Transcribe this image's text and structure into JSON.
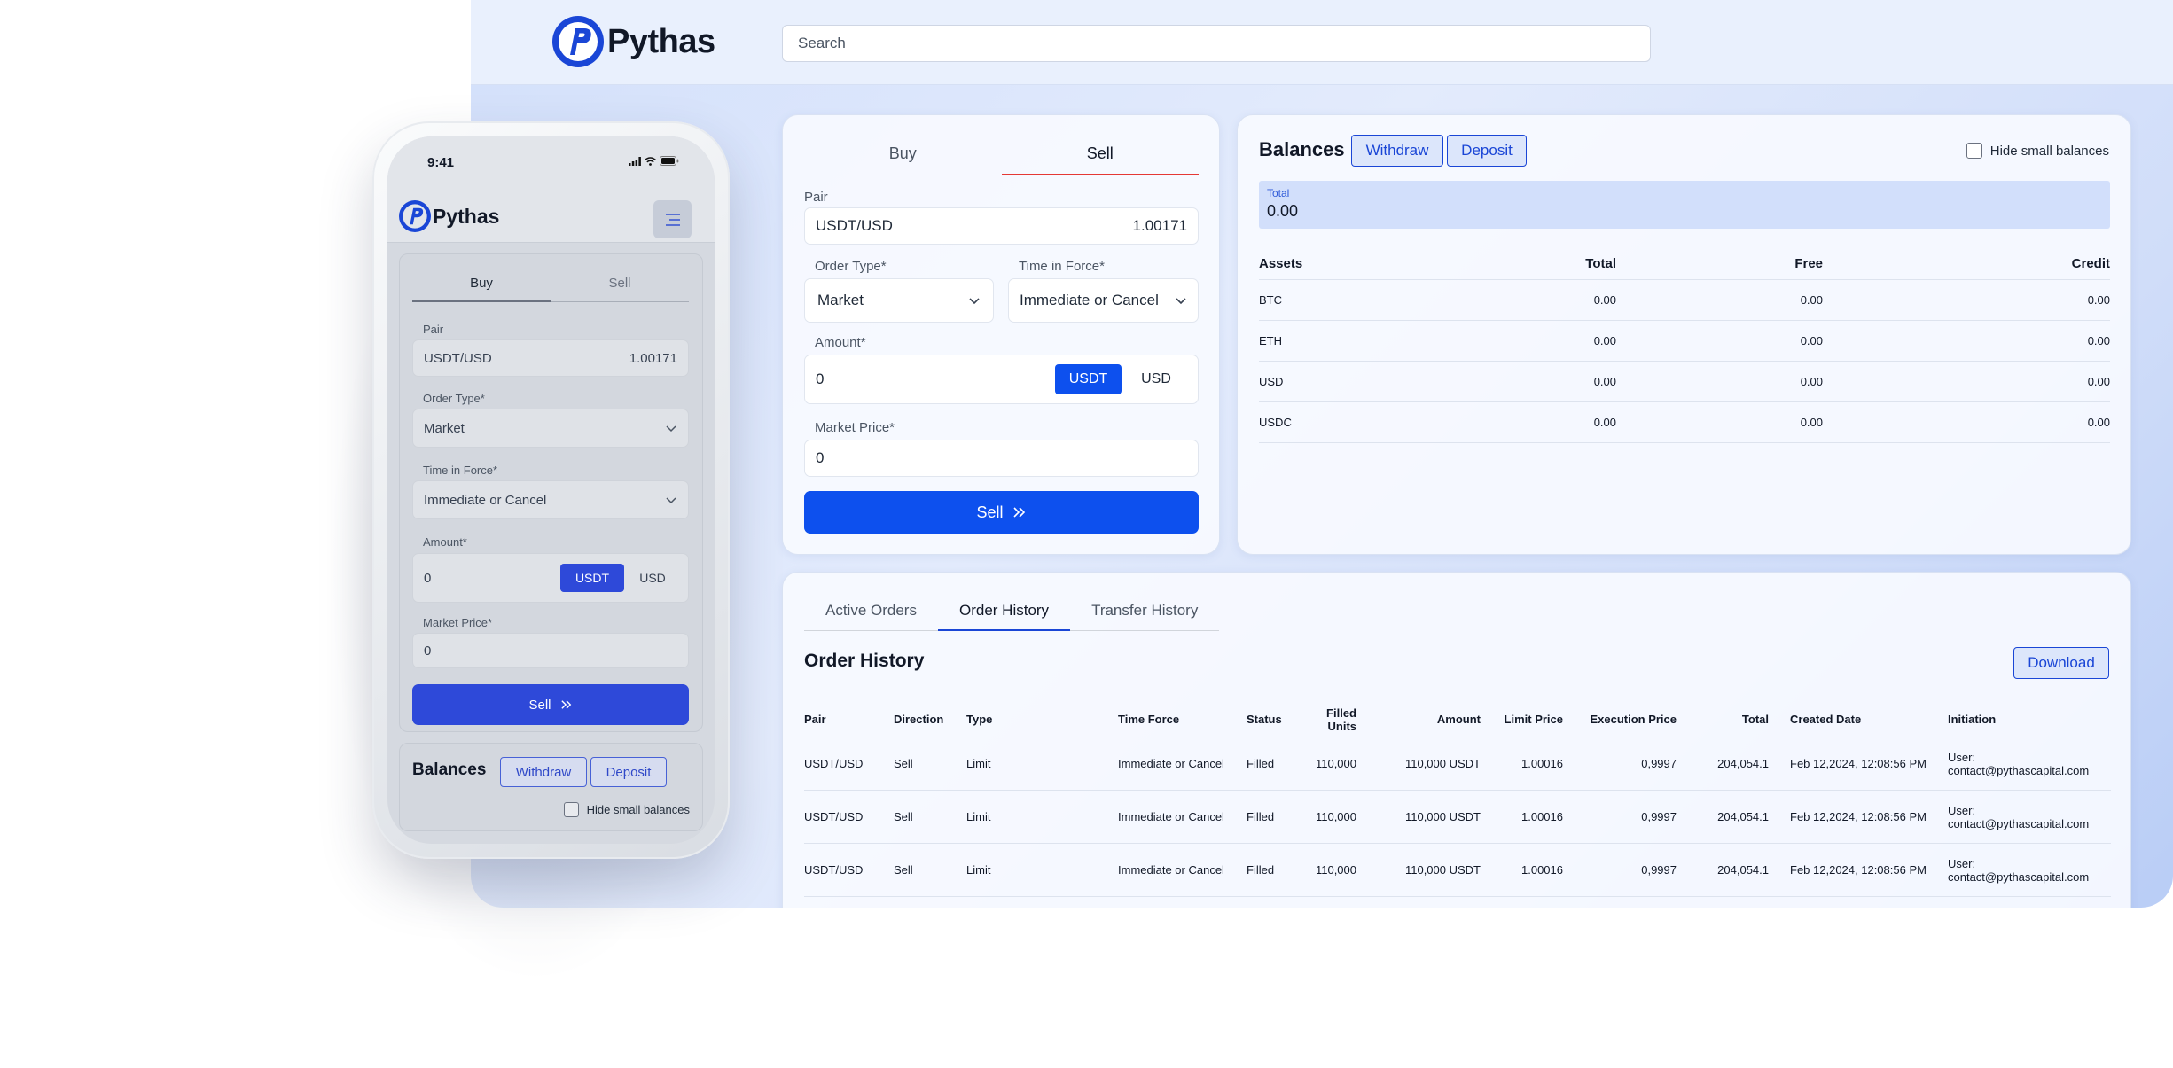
{
  "brand": {
    "name": "Pythas",
    "accent": "#0d50ee",
    "sell_tab_underline": "#e53935"
  },
  "desktop": {
    "search_placeholder": "Search",
    "trade": {
      "tabs": [
        {
          "label": "Buy"
        },
        {
          "label": "Sell",
          "active": true
        }
      ],
      "pair_label": "Pair",
      "pair_value": "USDT/USD",
      "pair_price": "1.00171",
      "order_type_label": "Order Type*",
      "order_type_value": "Market",
      "tif_label": "Time in Force*",
      "tif_value": "Immediate or Cancel",
      "amount_label": "Amount*",
      "amount_value": "0",
      "currency_options": [
        "USDT",
        "USD"
      ],
      "market_price_label": "Market Price*",
      "market_price_value": "0",
      "submit_label": "Sell"
    },
    "balances": {
      "title": "Balances",
      "withdraw_label": "Withdraw",
      "deposit_label": "Deposit",
      "hide_small_label": "Hide small balances",
      "total_label": "Total",
      "total_value": "0.00",
      "columns": [
        "Assets",
        "Total",
        "Free",
        "Credit"
      ],
      "rows": [
        [
          "BTC",
          "0.00",
          "0.00",
          "0.00"
        ],
        [
          "ETH",
          "0.00",
          "0.00",
          "0.00"
        ],
        [
          "USD",
          "0.00",
          "0.00",
          "0.00"
        ],
        [
          "USDC",
          "0.00",
          "0.00",
          "0.00"
        ]
      ]
    },
    "history": {
      "tabs": [
        {
          "label": "Active Orders"
        },
        {
          "label": "Order History",
          "active": true
        },
        {
          "label": "Transfer History"
        }
      ],
      "title": "Order History",
      "download_label": "Download",
      "columns": [
        "Pair",
        "Direction",
        "Type",
        "Time Force",
        "Status",
        "Filled Units",
        "Amount",
        "Limit Price",
        "Execution Price",
        "Total",
        "Created Date",
        "Initiation"
      ],
      "rows": [
        [
          "USDT/USD",
          "Sell",
          "Limit",
          "Immediate or Cancel",
          "Filled",
          "110,000",
          "110,000 USDT",
          "1.00016",
          "0,9997",
          "204,054.1",
          "Feb 12,2024, 12:08:56 PM",
          "User: contact@pythascapital.com"
        ],
        [
          "USDT/USD",
          "Sell",
          "Limit",
          "Immediate or Cancel",
          "Filled",
          "110,000",
          "110,000 USDT",
          "1.00016",
          "0,9997",
          "204,054.1",
          "Feb 12,2024, 12:08:56 PM",
          "User: contact@pythascapital.com"
        ],
        [
          "USDT/USD",
          "Sell",
          "Limit",
          "Immediate or Cancel",
          "Filled",
          "110,000",
          "110,000 USDT",
          "1.00016",
          "0,9997",
          "204,054.1",
          "Feb 12,2024, 12:08:56 PM",
          "User: contact@pythascapital.com"
        ]
      ]
    }
  },
  "mobile": {
    "status_time": "9:41",
    "trade": {
      "tabs": [
        {
          "label": "Buy",
          "active": true
        },
        {
          "label": "Sell"
        }
      ],
      "pair_label": "Pair",
      "pair_value": "USDT/USD",
      "pair_price": "1.00171",
      "order_type_label": "Order Type*",
      "order_type_value": "Market",
      "tif_label": "Time in Force*",
      "tif_value": "Immediate or Cancel",
      "amount_label": "Amount*",
      "amount_value": "0",
      "currency_options": [
        "USDT",
        "USD"
      ],
      "market_price_label": "Market Price*",
      "market_price_value": "0",
      "submit_label": "Sell"
    },
    "balances": {
      "title": "Balances",
      "withdraw_label": "Withdraw",
      "deposit_label": "Deposit",
      "hide_small_label": "Hide small balances"
    }
  }
}
